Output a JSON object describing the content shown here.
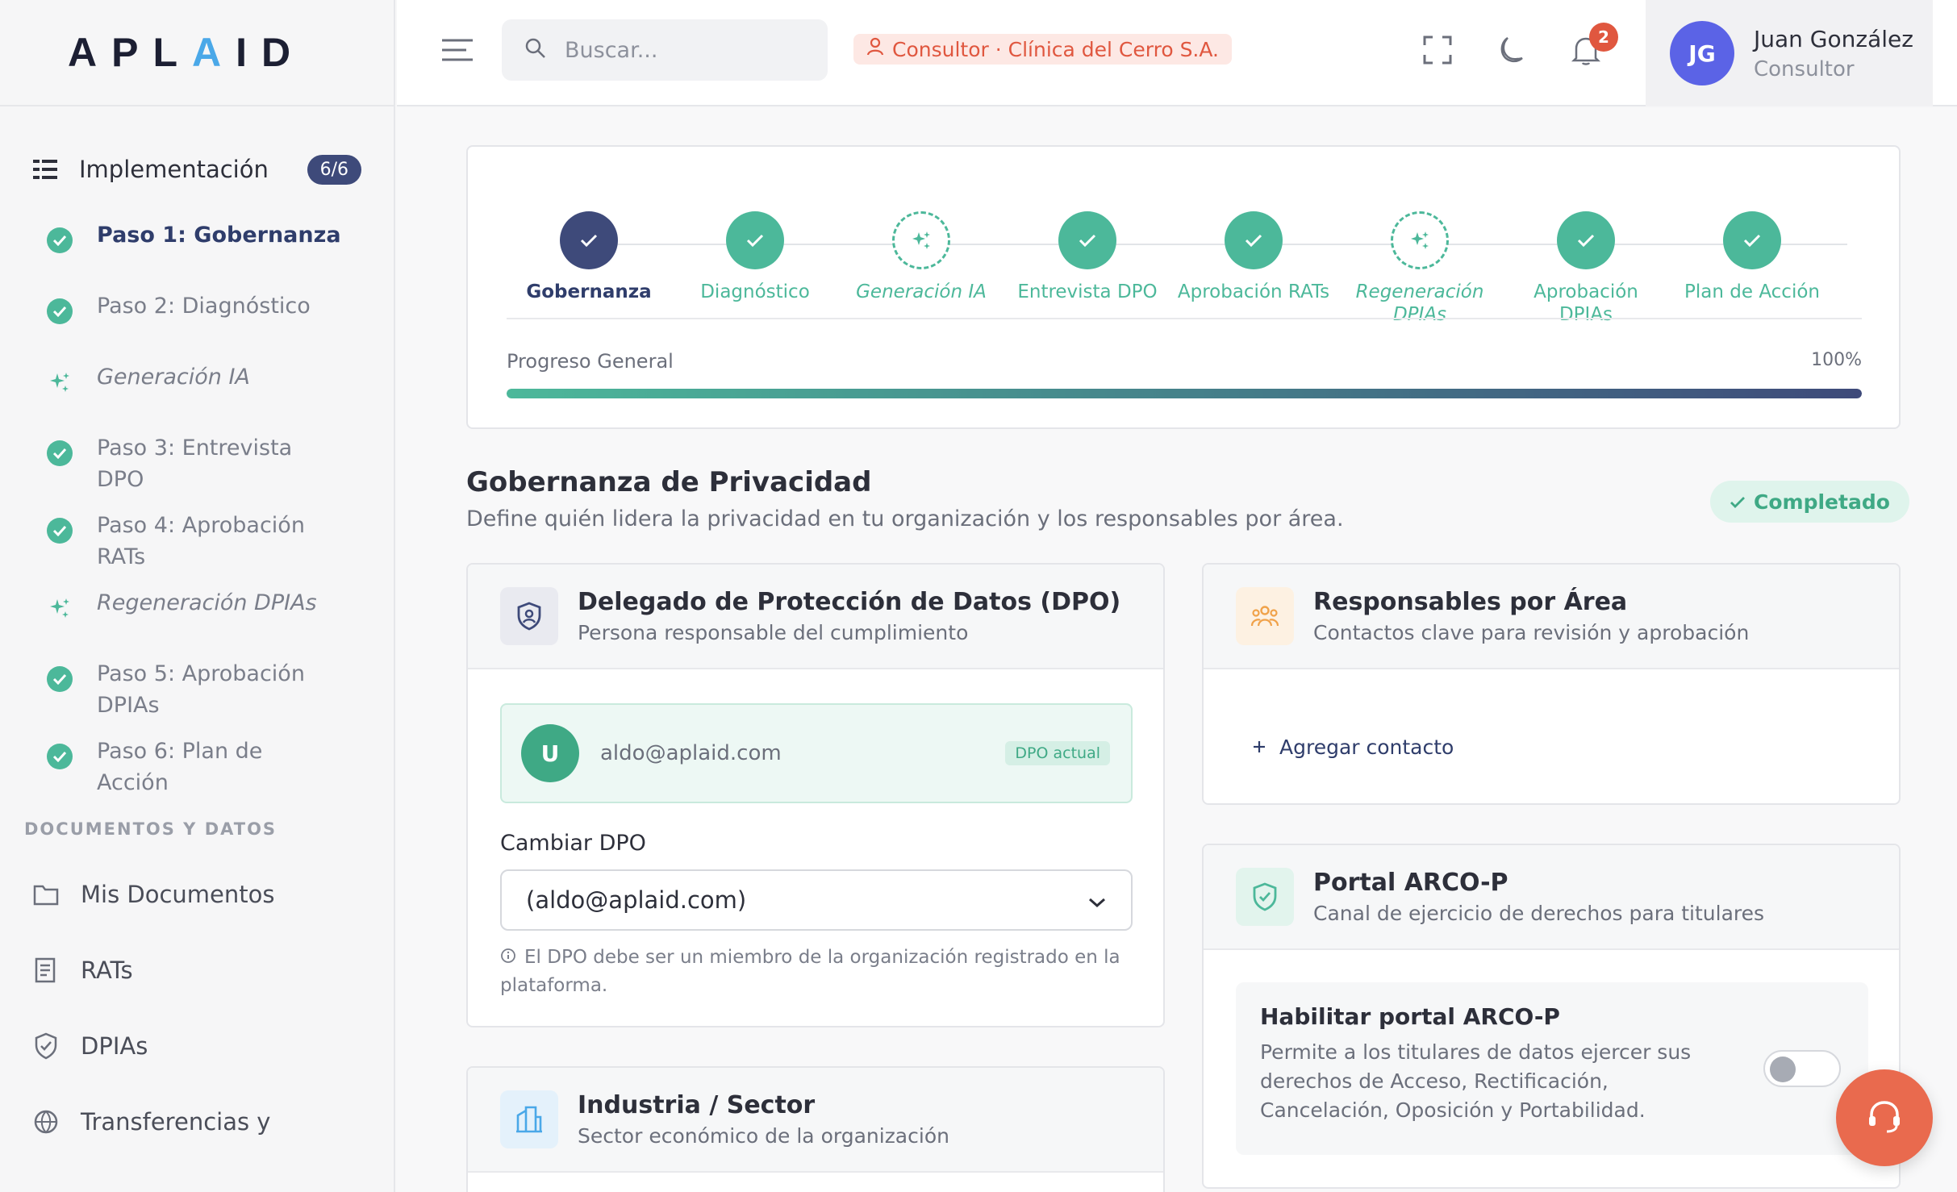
{
  "brand": {
    "logo_text_a": "APL",
    "logo_text_accent": "A",
    "logo_text_b": "ID"
  },
  "sidebar": {
    "implementation_label": "Implementación",
    "implementation_count": "6/6",
    "steps": [
      {
        "label": "Paso 1: Gobernanza",
        "state": "active",
        "icon": "check-icon"
      },
      {
        "label": "Paso 2: Diagnóstico",
        "state": "done",
        "icon": "check-icon"
      },
      {
        "label": "Generación IA",
        "state": "ai",
        "icon": "sparkle-icon"
      },
      {
        "label": "Paso 3: Entrevista DPO",
        "state": "done",
        "icon": "check-icon"
      },
      {
        "label": "Paso 4: Aprobación RATs",
        "state": "done",
        "icon": "check-icon"
      },
      {
        "label": "Regeneración DPIAs",
        "state": "ai",
        "icon": "sparkle-icon"
      },
      {
        "label": "Paso 5: Aprobación DPIAs",
        "state": "done",
        "icon": "check-icon"
      },
      {
        "label": "Paso 6: Plan de Acción",
        "state": "done",
        "icon": "check-icon"
      }
    ],
    "docs_heading": "DOCUMENTOS Y DATOS",
    "links": [
      {
        "label": "Mis Documentos",
        "icon": "folder-icon"
      },
      {
        "label": "RATs",
        "icon": "document-list-icon"
      },
      {
        "label": "DPIAs",
        "icon": "shield-icon"
      },
      {
        "label": "Transferencias y",
        "icon": "globe-icon"
      }
    ]
  },
  "topbar": {
    "search_placeholder": "Buscar...",
    "role_badge": "Consultor · Clínica del Cerro S.A.",
    "notification_count": "2",
    "user": {
      "initials": "JG",
      "name": "Juan González",
      "role": "Consultor"
    }
  },
  "stepper": {
    "steps": [
      {
        "label": "Gobernanza",
        "state": "current"
      },
      {
        "label": "Diagnóstico",
        "state": "done"
      },
      {
        "label": "Generación IA",
        "state": "ai"
      },
      {
        "label": "Entrevista DPO",
        "state": "done"
      },
      {
        "label": "Aprobación RATs",
        "state": "done"
      },
      {
        "label": "Regeneración DPIAs",
        "state": "ai"
      },
      {
        "label": "Aprobación DPIAs",
        "state": "done"
      },
      {
        "label": "Plan de Acción",
        "state": "done"
      }
    ],
    "progress_label": "Progreso General",
    "progress_text": "100%",
    "progress_value": 1.0
  },
  "section": {
    "title": "Gobernanza de Privacidad",
    "subtitle": "Define quién lidera la privacidad en tu organización y los responsables por área.",
    "status": "Completado"
  },
  "dpo_card": {
    "title": "Delegado de Protección de Datos (DPO)",
    "subtitle": "Persona responsable del cumplimiento",
    "current_initial": "U",
    "current_email": "aldo@aplaid.com",
    "current_tag": "DPO actual",
    "change_label": "Cambiar DPO",
    "select_value": "(aldo@aplaid.com)",
    "hint": "El DPO debe ser un miembro de la organización registrado en la plataforma."
  },
  "responsables_card": {
    "title": "Responsables por Área",
    "subtitle": "Contactos clave para revisión y aprobación",
    "add_label": "Agregar contacto"
  },
  "arco_card": {
    "title": "Portal ARCO-P",
    "subtitle": "Canal de ejercicio de derechos para titulares",
    "toggle_title": "Habilitar portal ARCO-P",
    "toggle_desc": "Permite a los titulares de datos ejercer sus derechos de Acceso, Rectificación, Cancelación, Oposición y Portabilidad.",
    "toggle_on": false
  },
  "industry_card": {
    "title": "Industria / Sector",
    "subtitle": "Sector económico de la organización"
  },
  "colors": {
    "primary": "#3e4a7a",
    "success": "#4cb89a",
    "accent": "#e0573f"
  }
}
